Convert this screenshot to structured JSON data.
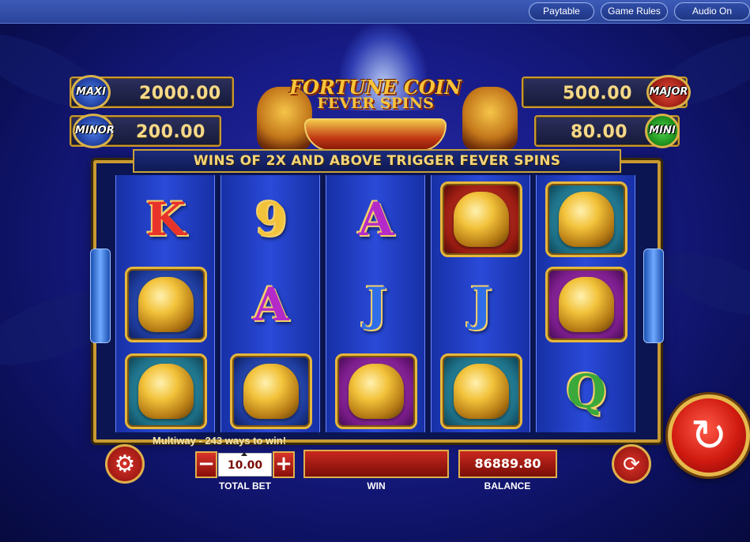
{
  "topbar": {
    "paytable": "Paytable",
    "game_rules": "Game Rules",
    "audio": "Audio On"
  },
  "logo": {
    "line1": "FORTUNE COIN",
    "line2": "FEVER SPINS"
  },
  "jackpots": {
    "maxi": {
      "label": "MAXI",
      "value": "2000.00"
    },
    "minor": {
      "label": "MINOR",
      "value": "200.00"
    },
    "major": {
      "label": "MAJOR",
      "value": "500.00"
    },
    "mini": {
      "label": "MINI",
      "value": "80.00"
    }
  },
  "banner": "WINS OF 2X AND ABOVE TRIGGER FEVER SPINS",
  "reels": [
    [
      "K",
      "bell",
      "vase"
    ],
    [
      "9",
      "A",
      "bell"
    ],
    [
      "A",
      "J",
      "fish"
    ],
    [
      "lion",
      "J",
      "vase"
    ],
    [
      "vase",
      "fish",
      "Q"
    ]
  ],
  "symbol_colors": {
    "K": "#e8332a",
    "9": "#f2c23a",
    "A": "#b42ac8",
    "J": "#2f6ee8",
    "Q": "#3aa83a"
  },
  "multiway": "Multiway - 243 ways to win!",
  "controls": {
    "bet_value": "10.00",
    "bet_minus": "−",
    "bet_plus": "+",
    "bet_label": "TOTAL BET",
    "win_value": "",
    "win_label": "WIN",
    "balance_value": "86889.80",
    "balance_label": "BALANCE"
  },
  "icons": {
    "settings": "gear-icon",
    "autoplay": "autoplay-icon",
    "spin": "spin-icon"
  }
}
